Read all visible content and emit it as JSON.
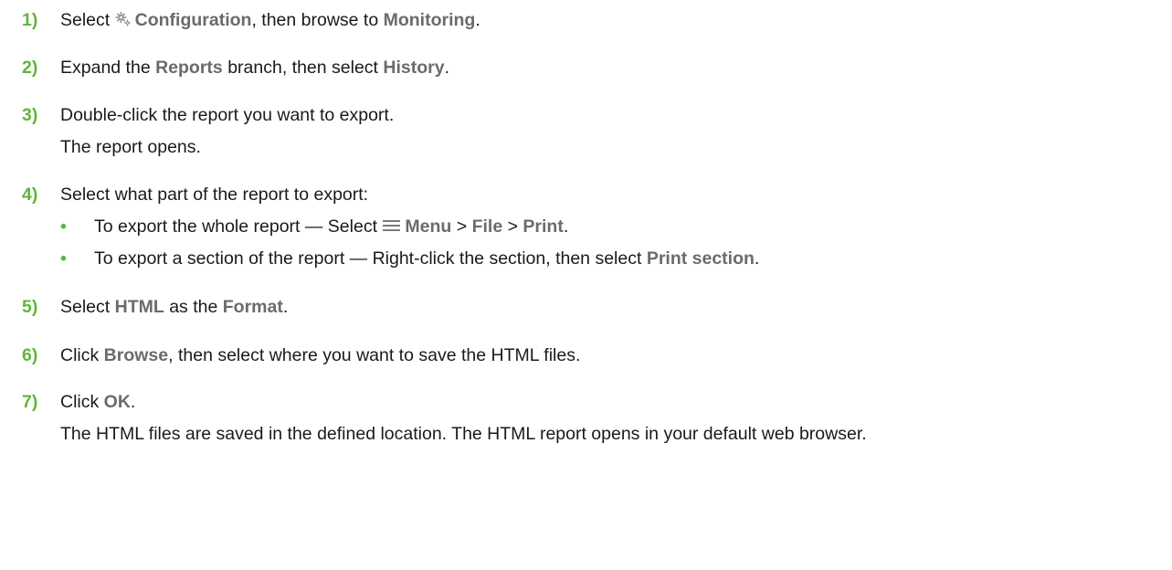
{
  "steps": [
    {
      "number": "1)",
      "select": "Select",
      "configuration": "Configuration",
      "then_browse": ", then browse to",
      "monitoring": "Monitoring",
      "period": ".",
      "icon": "gear-icon"
    },
    {
      "number": "2)",
      "expand": "Expand the",
      "reports": "Reports",
      "branch": "branch, then select",
      "history": "History",
      "period": "."
    },
    {
      "number": "3)",
      "text": "Double-click the report you want to export.",
      "result": "The report opens."
    },
    {
      "number": "4)",
      "text": "Select what part of the report to export:",
      "bullets": [
        {
          "marker": "•",
          "prefix": "To export the whole report — Select",
          "menu": "Menu",
          "sep1": ">",
          "file": "File",
          "sep2": ">",
          "print": "Print",
          "period": ".",
          "icon": "hamburger-menu-icon"
        },
        {
          "marker": "•",
          "prefix": "To export a section of the report — Right-click the section, then select",
          "print_section": "Print section",
          "period": "."
        }
      ]
    },
    {
      "number": "5)",
      "select": "Select",
      "html": "HTML",
      "as_the": "as the",
      "format": "Format",
      "period": "."
    },
    {
      "number": "6)",
      "click": "Click",
      "browse": "Browse",
      "rest": ", then select where you want to save the HTML files."
    },
    {
      "number": "7)",
      "click": "Click",
      "ok": "OK",
      "period": ".",
      "result": "The HTML files are saved in the defined location. The HTML report opens in your default web browser."
    }
  ],
  "colors": {
    "step_number": "#5fb63a",
    "ui_term": "#6b6b6b",
    "text": "#1a1a1a"
  }
}
